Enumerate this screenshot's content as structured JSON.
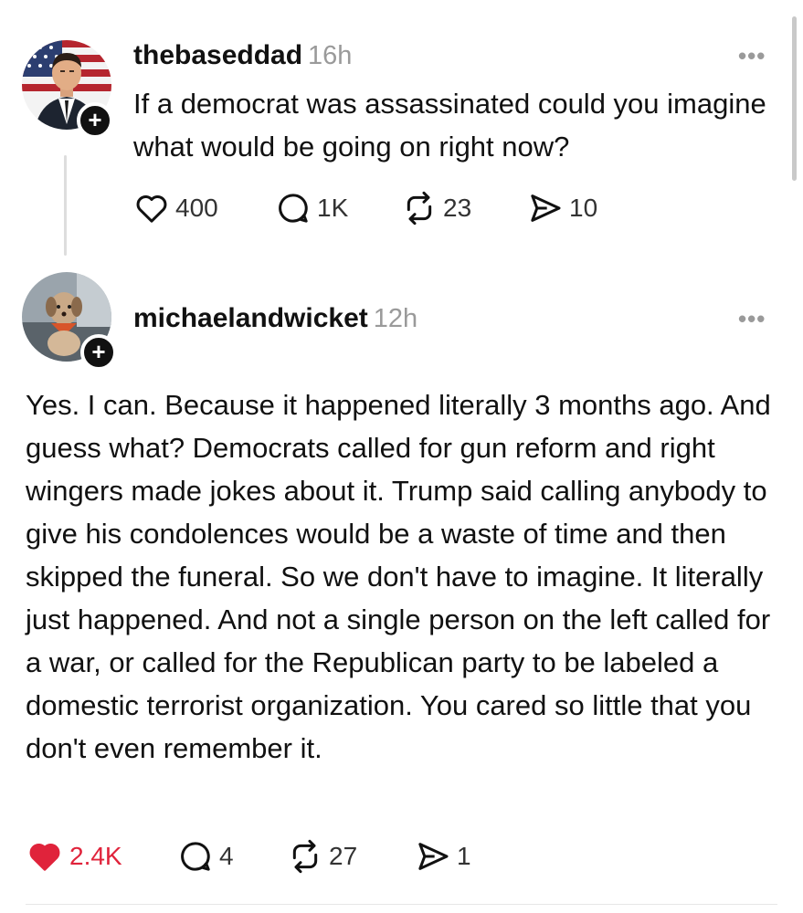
{
  "post": {
    "username": "thebaseddad",
    "time": "16h",
    "text": "If a democrat was assassinated could you imagine what would be going on right now?",
    "likes": "400",
    "replies": "1K",
    "reposts": "23",
    "shares": "10",
    "more": "•••"
  },
  "reply": {
    "username": "michaelandwicket",
    "time": "12h",
    "text": "Yes. I can. Because it happened literally 3 months ago. And guess what? Democrats called for gun reform and right wingers made jokes about it. Trump said calling anybody to give his condolences would be a waste of time and then skipped the funeral. So we don't have to imagine. It literally just happened. And not a single person on the left called for a war, or called for the Republican party to be labeled a domestic terrorist organization. You cared so little that you don't even remember it.",
    "likes": "2.4K",
    "replies": "4",
    "reposts": "27",
    "shares": "1",
    "more": "•••",
    "liked": true
  },
  "follow_symbol": "+",
  "colors": {
    "like_active": "#e0233b",
    "muted": "#9a9a9a"
  },
  "icons": [
    "heart-icon",
    "comment-icon",
    "repost-icon",
    "share-icon",
    "plus-icon",
    "more-icon"
  ]
}
